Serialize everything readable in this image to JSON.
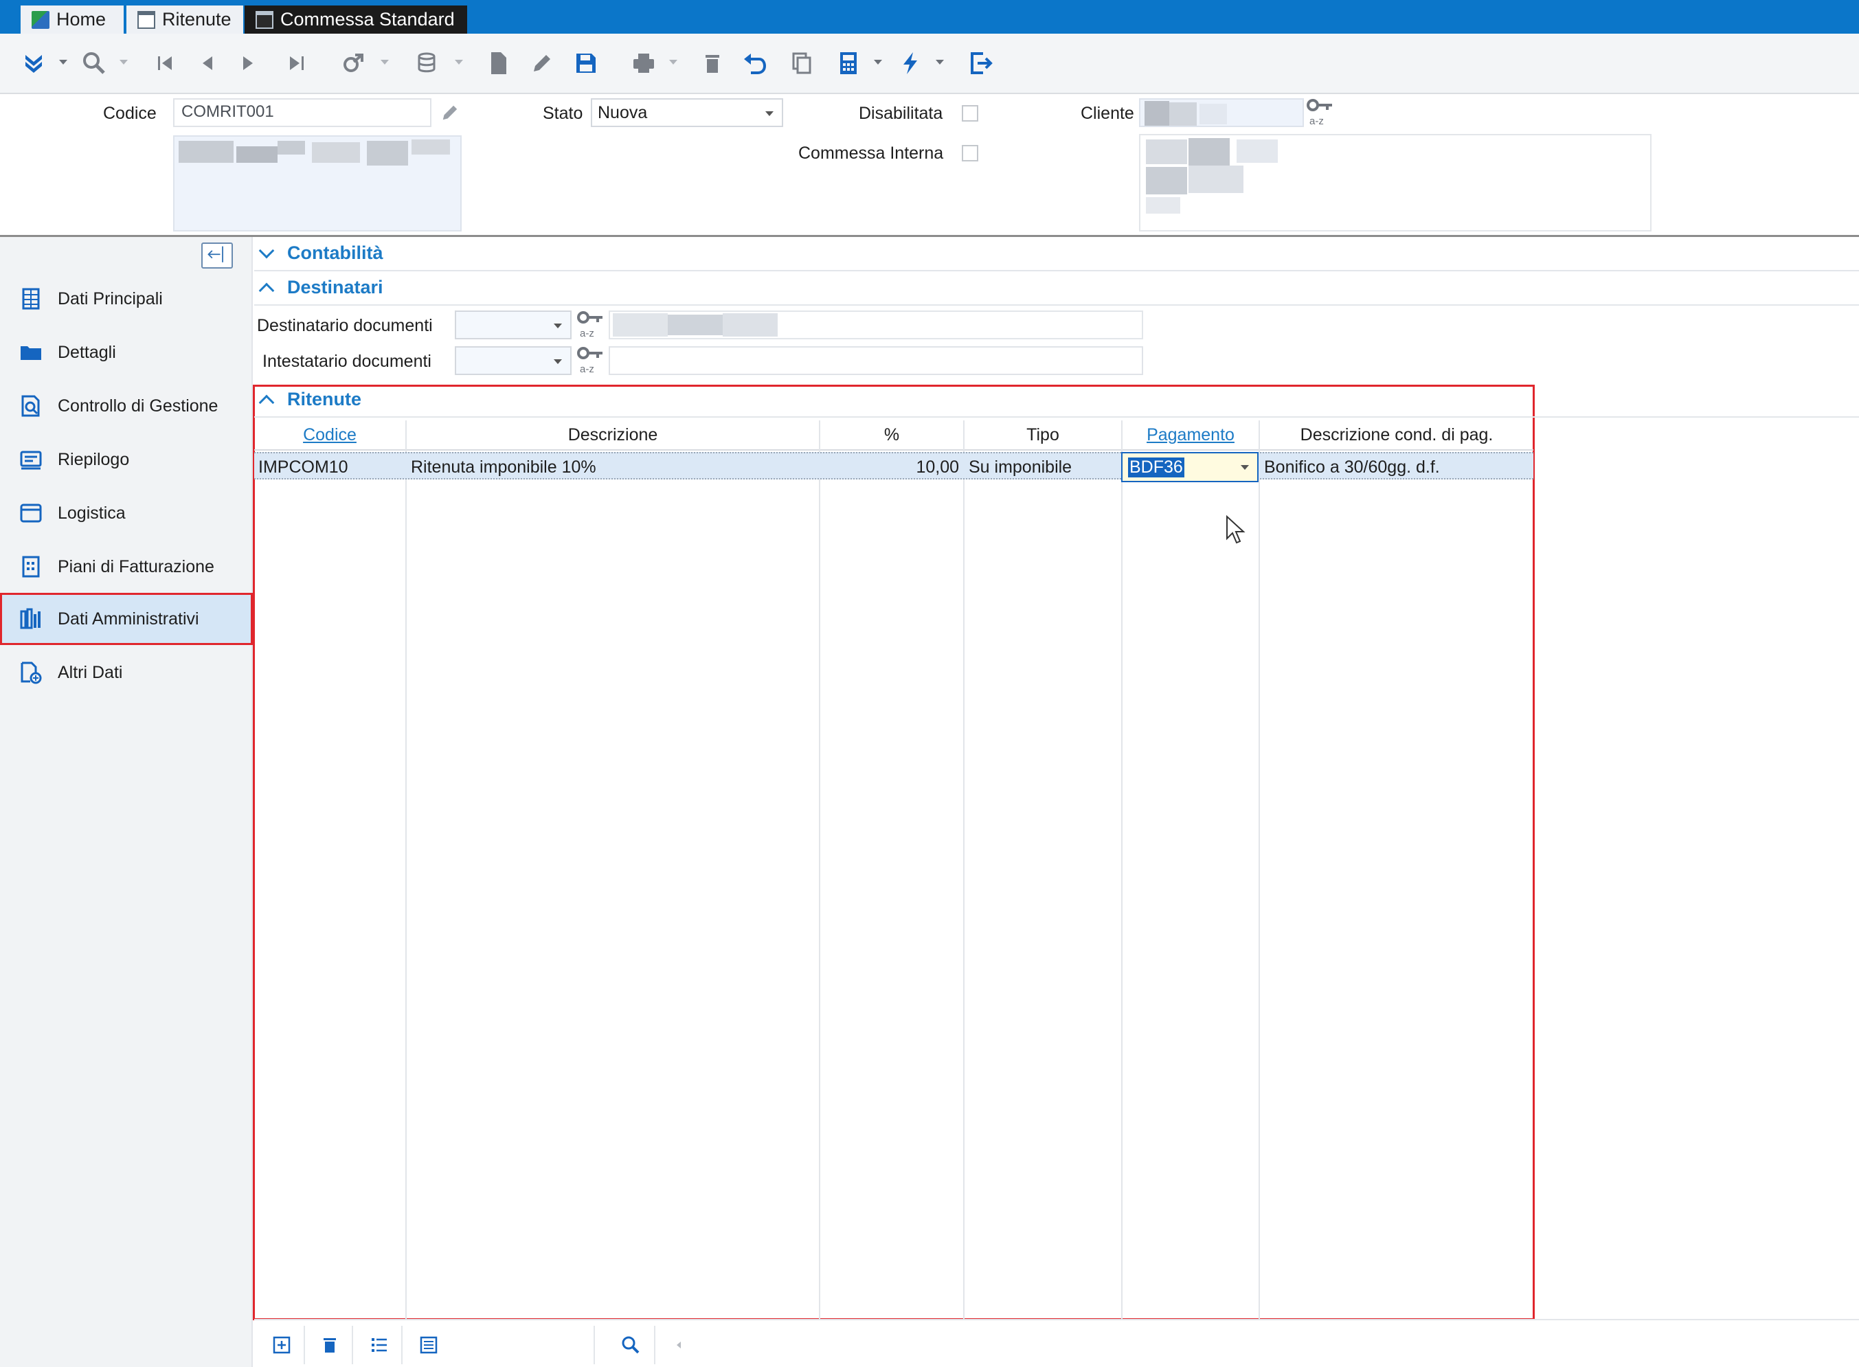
{
  "tabs": [
    {
      "label": "Home"
    },
    {
      "label": "Ritenute"
    },
    {
      "label": "Commessa Standard"
    }
  ],
  "toolbar": {
    "icons": [
      "expand-icon",
      "search-icon",
      "first-record-icon",
      "previous-record-icon",
      "next-record-icon",
      "last-record-icon",
      "link-icon",
      "database-icon",
      "new-document-icon",
      "edit-icon",
      "save-icon",
      "print-icon",
      "delete-icon",
      "undo-icon",
      "copy-icon",
      "calculator-icon",
      "lightning-icon",
      "exit-icon"
    ]
  },
  "header": {
    "codice_label": "Codice",
    "codice_value": "COMRIT001",
    "stato_label": "Stato",
    "stato_value": "Nuova",
    "disabilitata_label": "Disabilitata",
    "commessa_interna_label": "Commessa Interna",
    "cliente_label": "Cliente"
  },
  "sidebar": {
    "items": [
      {
        "label": "Dati Principali",
        "icon": "grid-icon"
      },
      {
        "label": "Dettagli",
        "icon": "folder-icon"
      },
      {
        "label": "Controllo di Gestione",
        "icon": "search-document-icon"
      },
      {
        "label": "Riepilogo",
        "icon": "summary-icon"
      },
      {
        "label": "Logistica",
        "icon": "box-icon"
      },
      {
        "label": "Piani di Fatturazione",
        "icon": "invoice-icon"
      },
      {
        "label": "Dati Amministrativi",
        "icon": "admin-icon"
      },
      {
        "label": "Altri Dati",
        "icon": "add-document-icon"
      }
    ],
    "selected": "Dati Amministrativi"
  },
  "sections": {
    "contabilita": "Contabilità",
    "destinatari": "Destinatari",
    "ritenute": "Ritenute"
  },
  "destinatari": {
    "destinatario_label": "Destinatario documenti",
    "intestatario_label": "Intestatario documenti"
  },
  "grid": {
    "columns": [
      "Codice",
      "Descrizione",
      "%",
      "Tipo",
      "Pagamento",
      "Descrizione cond. di pag."
    ],
    "rows": [
      {
        "codice": "IMPCOM10",
        "descrizione": "Ritenuta imponibile 10%",
        "percentuale": "10,00",
        "tipo": "Su imponibile",
        "pagamento": "BDF36",
        "descrizione_cond": "Bonifico a 30/60gg. d.f."
      }
    ]
  },
  "colors": {
    "accent": "#1d7bc6",
    "highlight": "#e0262d",
    "tabbar": "#0b76c9",
    "selected_row": "#dbe8f6"
  }
}
